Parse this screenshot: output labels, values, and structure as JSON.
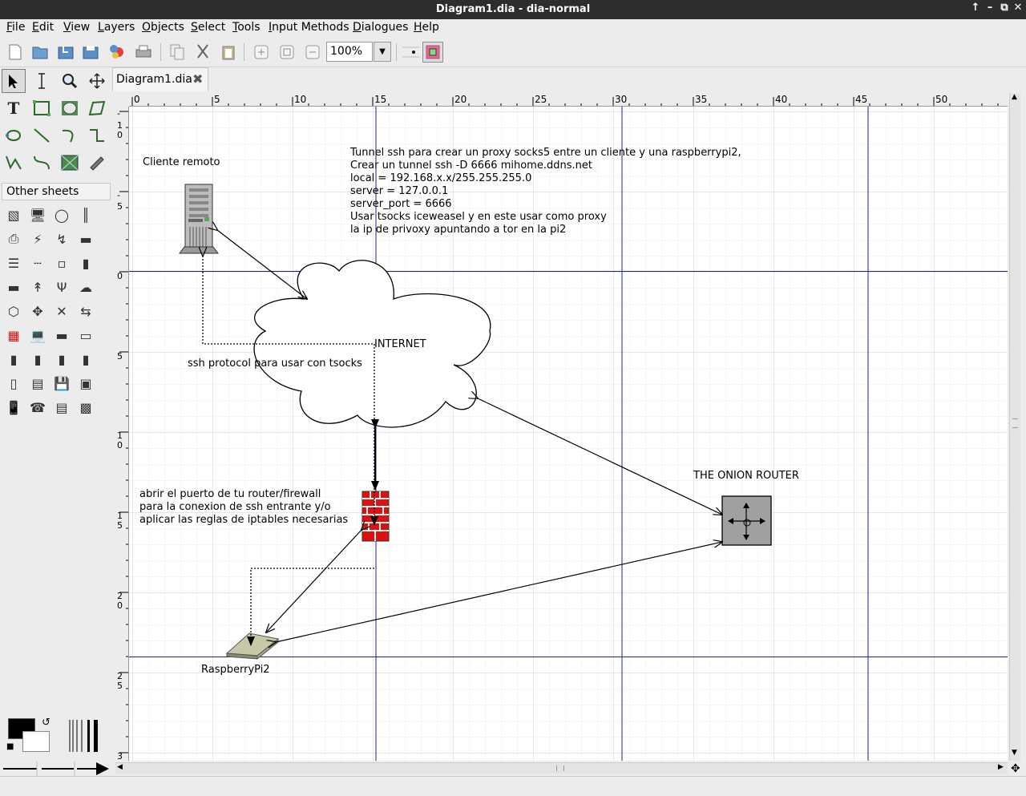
{
  "window": {
    "title": "Diagram1.dia - dia-normal",
    "controls": [
      "↑",
      "–",
      "⧉",
      "✕"
    ]
  },
  "menu": [
    "File",
    "Edit",
    "View",
    "Layers",
    "Objects",
    "Select",
    "Tools",
    "Input Methods",
    "Dialogues",
    "Help"
  ],
  "toolbar": {
    "zoom_value": "100%",
    "icons": [
      "new-file-icon",
      "open-file-icon",
      "save-icon",
      "save-as-icon",
      "export-icon",
      "print-icon",
      "copy-icon",
      "cut-icon",
      "paste-icon",
      "zoom-in-icon",
      "zoom-fit-icon",
      "zoom-out-icon",
      "snap-to-grid-icon",
      "snap-to-objects-icon"
    ]
  },
  "toolbox": {
    "tools": [
      "modify-tool",
      "text-edit-tool",
      "magnify-tool",
      "scroll-tool",
      "text-tool",
      "box-tool",
      "ellipse-tool",
      "polygon-tool",
      "beziergon-tool",
      "line-tool",
      "arc-tool",
      "zigzagline-tool",
      "polyline-tool",
      "bezierline-tool",
      "image-tool",
      "outline-tool"
    ],
    "sheet_label": "Other sheets",
    "shapes_count": 32
  },
  "tab": {
    "label": "Diagram1.dia",
    "close": "✖"
  },
  "ruler": {
    "h_labels": [
      "0",
      "5",
      "10",
      "15",
      "20",
      "25",
      "30",
      "35",
      "40",
      "45",
      "50"
    ],
    "v_labels": [
      "-",
      "1\n0",
      "-",
      "5",
      "0",
      "5",
      "1\n0",
      "1\n5",
      "2\n0",
      "2\n5",
      "3"
    ]
  },
  "diagram": {
    "labels": {
      "cliente": "Cliente remoto",
      "internet": "INTERNET",
      "ssh": "ssh protocol para usar con tsocks",
      "onion": "THE ONION ROUTER",
      "raspberry": "RaspberryPi2"
    },
    "notes": [
      "Tunnel ssh para crear un proxy socks5 entre un cliente y una raspberrypi2,",
      "Crear un tunnel ssh -D 6666 mihome.ddns.net",
      "local = 192.168.x.x/255.255.255.0",
      "server = 127.0.0.1",
      "server_port = 6666",
      "Usar tsocks iceweasel y en este usar como proxy",
      "la ip de privoxy apuntando a tor en la pi2"
    ],
    "router_note": [
      "abrir el puerto de tu router/firewall",
      "para la conexion de ssh entrante y/o",
      "aplicar las reglas de iptables necesarias"
    ]
  },
  "colors": {
    "firewall": "#e01010",
    "guide": "#1a237e",
    "grid": "#dde2ea",
    "onion_box": "#a0a0a0"
  }
}
